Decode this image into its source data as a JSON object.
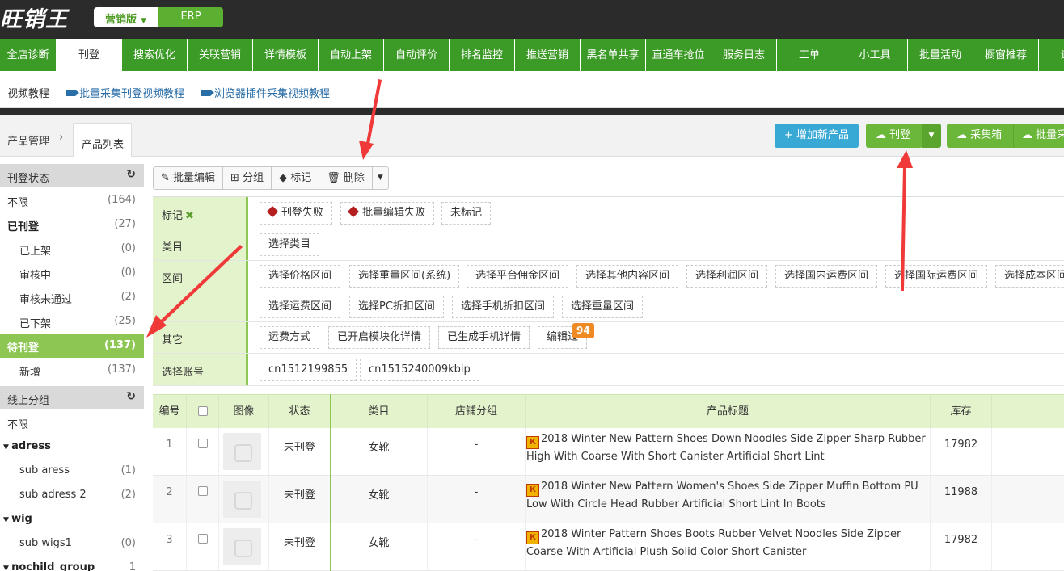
{
  "app": {
    "logo": "旺销王",
    "edition": "营销版",
    "erp": "ERP"
  },
  "nav": [
    "全店诊断",
    "刊登",
    "搜索优化",
    "关联营销",
    "详情模板",
    "自动上架",
    "自动评价",
    "排名监控",
    "推送营销",
    "黑名单共享",
    "直通车抢位",
    "服务日志",
    "工单",
    "小工具",
    "批量活动",
    "橱窗推荐",
    "运营"
  ],
  "nav_active": "刊登",
  "videos": {
    "label": "视频教程",
    "link1": "批量采集刊登视频教程",
    "link2": "浏览器插件采集视频教程"
  },
  "breadcrumb": {
    "root": "产品管理",
    "sep": "›",
    "current": "产品列表"
  },
  "actions": {
    "add": "+ 增加新产品",
    "publish": "刊登",
    "collect": "采集箱",
    "batch": "批量采"
  },
  "sidebar": {
    "section1": "刊登状态",
    "items1": [
      {
        "label": "不限",
        "count": "(164)"
      },
      {
        "label": "已刊登",
        "count": "(27)"
      },
      {
        "label": "已上架",
        "count": "(0)"
      },
      {
        "label": "审核中",
        "count": "(0)"
      },
      {
        "label": "审核未通过",
        "count": "(2)"
      },
      {
        "label": "已下架",
        "count": "(25)"
      },
      {
        "label": "待刊登",
        "count": "(137)"
      },
      {
        "label": "新增",
        "count": "(137)"
      }
    ],
    "section2": "线上分组",
    "items2": [
      {
        "label": "不限",
        "count": ""
      },
      {
        "label": "adress",
        "count": ""
      },
      {
        "label": "sub aress",
        "count": "(1)"
      },
      {
        "label": "sub adress 2",
        "count": "(2)"
      },
      {
        "label": "wig",
        "count": ""
      },
      {
        "label": "sub wigs1",
        "count": "(0)"
      },
      {
        "label": "nochild_group",
        "count": "1"
      }
    ]
  },
  "toolbar": {
    "batch_edit": "批量编辑",
    "group": "分组",
    "mark": "标记",
    "delete": "删除"
  },
  "filters": {
    "mark_label": "标记",
    "mark_chips": [
      "刊登失败",
      "批量编辑失败",
      "未标记"
    ],
    "category_label": "类目",
    "category_chip": "选择类目",
    "range_label": "区间",
    "range_chips_row1": [
      "选择价格区间",
      "选择重量区间(系统)",
      "选择平台佣金区间",
      "选择其他内容区间",
      "选择利润区间",
      "选择国内运费区间",
      "选择国际运费区间",
      "选择成本区间"
    ],
    "range_chips_row2": [
      "选择运费区间",
      "选择PC折扣区间",
      "选择手机折扣区间",
      "选择重量区间"
    ],
    "other_label": "其它",
    "other_chips": [
      "运费方式",
      "已开启模块化详情",
      "已生成手机详情",
      "编辑过"
    ],
    "edited_badge": "94",
    "account_label": "选择账号",
    "account_chips": [
      "cn1512199855",
      "cn1515240009kbip"
    ]
  },
  "table": {
    "headers": [
      "编号",
      "",
      "图像",
      "状态",
      "类目",
      "店铺分组",
      "产品标题",
      "库存"
    ],
    "rows": [
      {
        "no": "1",
        "status": "未刊登",
        "category": "女靴",
        "group": "-",
        "title": "2018 Winter New Pattern Shoes Down Noodles Side Zipper Sharp Rubber High With Coarse With Short Canister Artificial Short Lint",
        "stock": "17982"
      },
      {
        "no": "2",
        "status": "未刊登",
        "category": "女靴",
        "group": "-",
        "title": "2018 Winter New Pattern Women's Shoes Side Zipper Muffin Bottom PU Low With Circle Head Rubber Artificial Short Lint In Boots",
        "stock": "11988"
      },
      {
        "no": "3",
        "status": "未刊登",
        "category": "女靴",
        "group": "-",
        "title": "2018 Winter Pattern Shoes Boots Rubber Velvet Noodles Side Zipper Coarse With Artificial Plush Solid Color Short Canister",
        "stock": "17982"
      }
    ]
  },
  "colors": {
    "nav_green": "#3c9a27",
    "accent_green": "#8dc653",
    "button_blue": "#38a8d5",
    "badge_orange": "#f08a24",
    "arrow_red": "#f03a3a"
  }
}
